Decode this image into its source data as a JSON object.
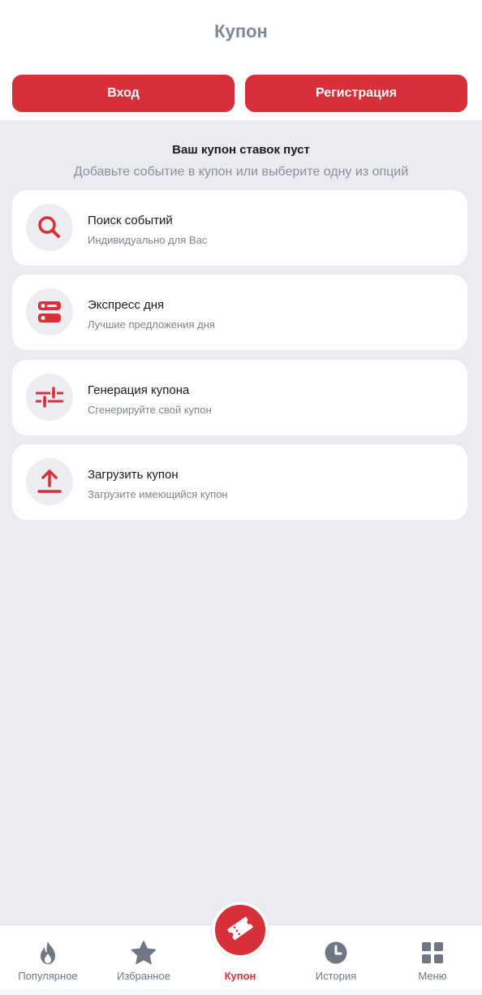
{
  "header": {
    "title": "Купон",
    "login_label": "Вход",
    "register_label": "Регистрация"
  },
  "empty_state": {
    "title": "Ваш купон ставок пуст",
    "subtitle": "Добавьте событие в купон или выберите одну из опций"
  },
  "options": [
    {
      "icon": "search-icon",
      "title": "Поиск событий",
      "subtitle": "Индивидуально для Вас"
    },
    {
      "icon": "express-icon",
      "title": "Экспресс дня",
      "subtitle": "Лучшие предложения дня"
    },
    {
      "icon": "sliders-icon",
      "title": "Генерация купона",
      "subtitle": "Сгенерируйте свой купон"
    },
    {
      "icon": "upload-icon",
      "title": "Загрузить купон",
      "subtitle": "Загрузите имеющийся купон"
    }
  ],
  "bottom_nav": [
    {
      "icon": "flame-icon",
      "label": "Популярное"
    },
    {
      "icon": "star-icon",
      "label": "Избранное"
    },
    {
      "icon": "ticket-icon",
      "label": "Купон",
      "active": true
    },
    {
      "icon": "clock-icon",
      "label": "История"
    },
    {
      "icon": "grid-icon",
      "label": "Меню"
    }
  ],
  "colors": {
    "accent": "#d83039",
    "background": "#e9ebee",
    "inactive_nav": "#6f7784"
  }
}
